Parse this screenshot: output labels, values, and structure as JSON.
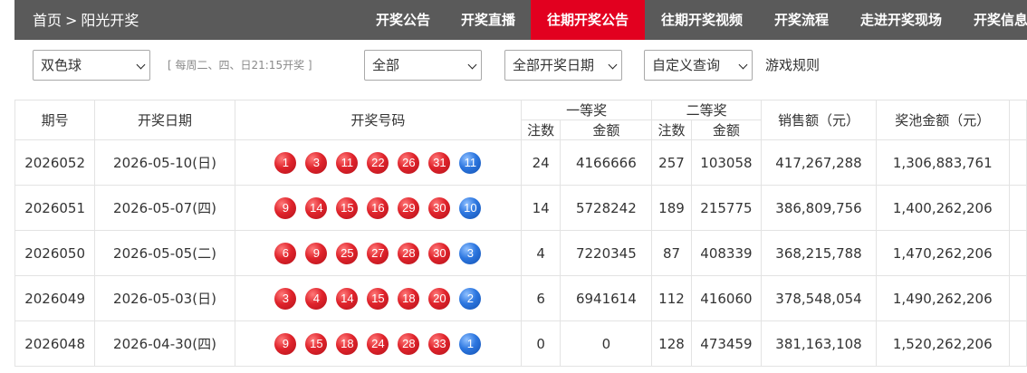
{
  "breadcrumb": {
    "home": "首页",
    "separator": ">",
    "current": "阳光开奖"
  },
  "nav": {
    "items": [
      "开奖公告",
      "开奖直播",
      "往期开奖公告",
      "往期开奖视频",
      "开奖流程",
      "走进开奖现场",
      "开奖信息"
    ],
    "active_index": 2,
    "active_color": "#e2001f"
  },
  "filters": {
    "lottery": "双色球",
    "draw_note": "[ 每周二、四、日21:15开奖 ]",
    "scope": "全部",
    "date_range": "全部开奖日期",
    "custom_query": "自定义查询",
    "rules_link": "游戏规则"
  },
  "table": {
    "headers": {
      "period": "期号",
      "date": "开奖日期",
      "numbers": "开奖号码",
      "first_prize": "一等奖",
      "second_prize": "二等奖",
      "count": "注数",
      "amount": "金额",
      "sales": "销售额（元）",
      "pool": "奖池金额（元）"
    },
    "rows": [
      {
        "period": "2026052",
        "date": "2026-05-10(日)",
        "red": [
          "1",
          "3",
          "11",
          "22",
          "26",
          "31"
        ],
        "blue": "11",
        "first_count": "24",
        "first_amount": "4166666",
        "second_count": "257",
        "second_amount": "103058",
        "sales": "417,267,288",
        "pool": "1,306,883,761"
      },
      {
        "period": "2026051",
        "date": "2026-05-07(四)",
        "red": [
          "9",
          "14",
          "15",
          "16",
          "29",
          "30"
        ],
        "blue": "10",
        "first_count": "14",
        "first_amount": "5728242",
        "second_count": "189",
        "second_amount": "215775",
        "sales": "386,809,756",
        "pool": "1,400,262,206"
      },
      {
        "period": "2026050",
        "date": "2026-05-05(二)",
        "red": [
          "6",
          "9",
          "25",
          "27",
          "28",
          "30"
        ],
        "blue": "3",
        "first_count": "4",
        "first_amount": "7220345",
        "second_count": "87",
        "second_amount": "408339",
        "sales": "368,215,788",
        "pool": "1,470,262,206"
      },
      {
        "period": "2026049",
        "date": "2026-05-03(日)",
        "red": [
          "3",
          "4",
          "14",
          "15",
          "18",
          "20"
        ],
        "blue": "2",
        "first_count": "6",
        "first_amount": "6941614",
        "second_count": "112",
        "second_amount": "416060",
        "sales": "378,548,054",
        "pool": "1,490,262,206"
      },
      {
        "period": "2026048",
        "date": "2026-04-30(四)",
        "red": [
          "9",
          "15",
          "18",
          "24",
          "28",
          "33"
        ],
        "blue": "1",
        "first_count": "0",
        "first_amount": "0",
        "second_count": "128",
        "second_amount": "473459",
        "sales": "381,163,108",
        "pool": "1,520,262,206"
      }
    ]
  },
  "colors": {
    "topbar_bg": "#5a5a5a",
    "red_ball": "#e0242c",
    "blue_ball": "#2d77e0",
    "border": "#e3e3e3"
  }
}
